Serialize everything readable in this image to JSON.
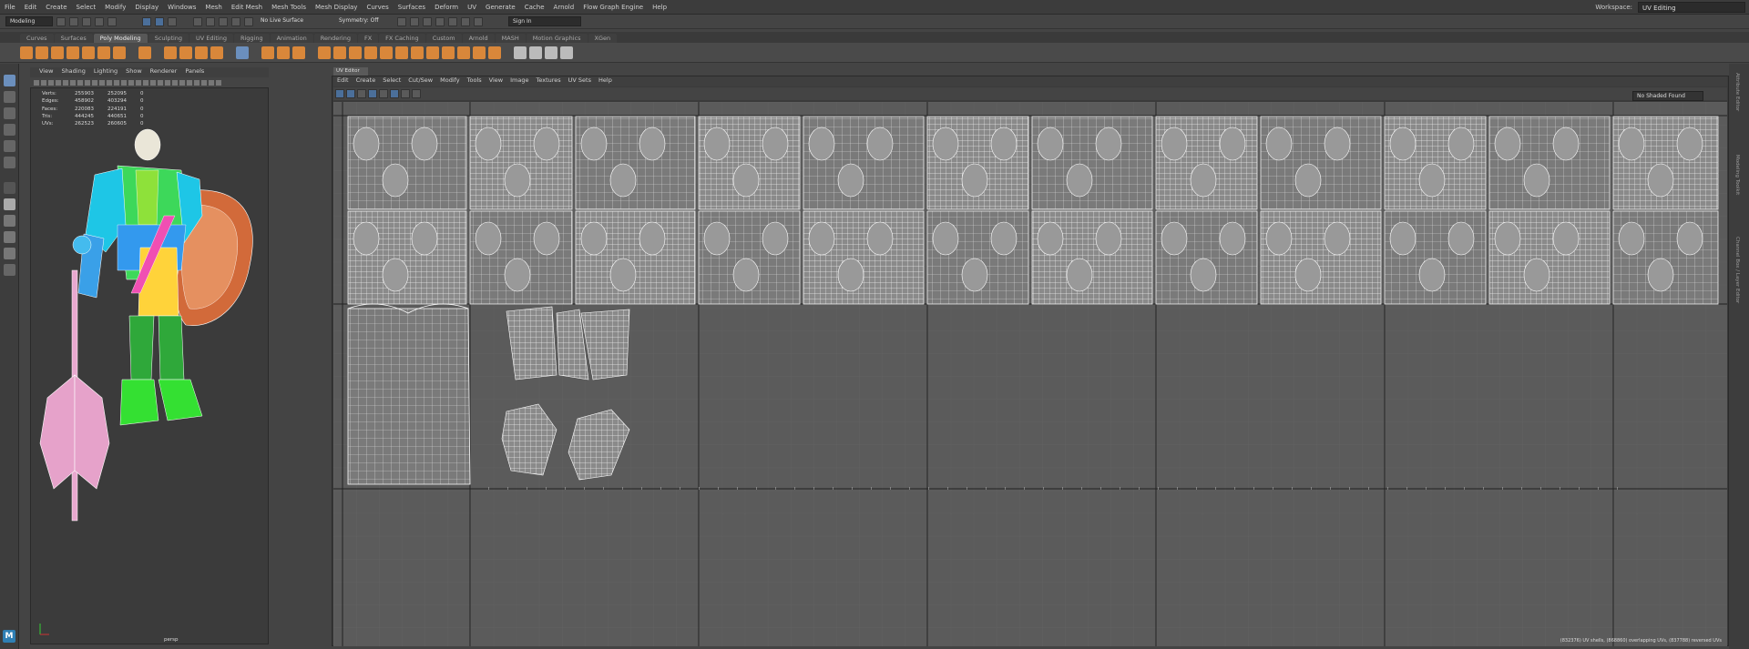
{
  "menubar": {
    "items": [
      "File",
      "Edit",
      "Create",
      "Select",
      "Modify",
      "Display",
      "Windows",
      "Mesh",
      "Edit Mesh",
      "Mesh Tools",
      "Mesh Display",
      "Curves",
      "Surfaces",
      "Deform",
      "UV",
      "Generate",
      "Cache",
      "Arnold",
      "Flow Graph Engine",
      "Help"
    ],
    "workspace_label": "Workspace:",
    "workspace_value": "UV Editing"
  },
  "statusline": {
    "mode": "Modeling",
    "live_surface": "No Live Surface",
    "symmetry": "Symmetry: Off",
    "sign_in": "Sign In"
  },
  "shelf": {
    "tabs": [
      "Curves",
      "Surfaces",
      "Poly Modeling",
      "Sculpting",
      "UV Editing",
      "Rigging",
      "Animation",
      "Rendering",
      "FX",
      "FX Caching",
      "Custom",
      "Arnold",
      "MASH",
      "Motion Graphics",
      "XGen"
    ],
    "active_tab": "Poly Modeling"
  },
  "persp": {
    "menu": [
      "View",
      "Shading",
      "Lighting",
      "Show",
      "Renderer",
      "Panels"
    ],
    "hud": [
      {
        "label": "Verts:",
        "a": "255903",
        "b": "252095",
        "c": "0"
      },
      {
        "label": "Edges:",
        "a": "458902",
        "b": "403294",
        "c": "0"
      },
      {
        "label": "Faces:",
        "a": "220083",
        "b": "224191",
        "c": "0"
      },
      {
        "label": "Tris:",
        "a": "444245",
        "b": "440651",
        "c": "0"
      },
      {
        "label": "UVs:",
        "a": "262523",
        "b": "260605",
        "c": "0"
      }
    ],
    "camera": "persp"
  },
  "uv_editor": {
    "title": "UV Editor",
    "menu": [
      "Edit",
      "Create",
      "Select",
      "Cut/Sew",
      "Modify",
      "Tools",
      "View",
      "Image",
      "Textures",
      "UV Sets",
      "Help"
    ],
    "filter_placeholder": "No Shaded Found",
    "status": "(832376) UV shells, (868860) overlapping UVs, (837788) reversed UVs"
  },
  "right_strip": [
    "Attribute Editor",
    "Modeling Toolkit",
    "Channel Box / Layer Editor"
  ],
  "colors": {
    "ui_bg": "#444444",
    "uv_bg": "#5b5b5b",
    "accent_orange": "#d9873a",
    "highlight_blue": "#4b6f9a"
  }
}
